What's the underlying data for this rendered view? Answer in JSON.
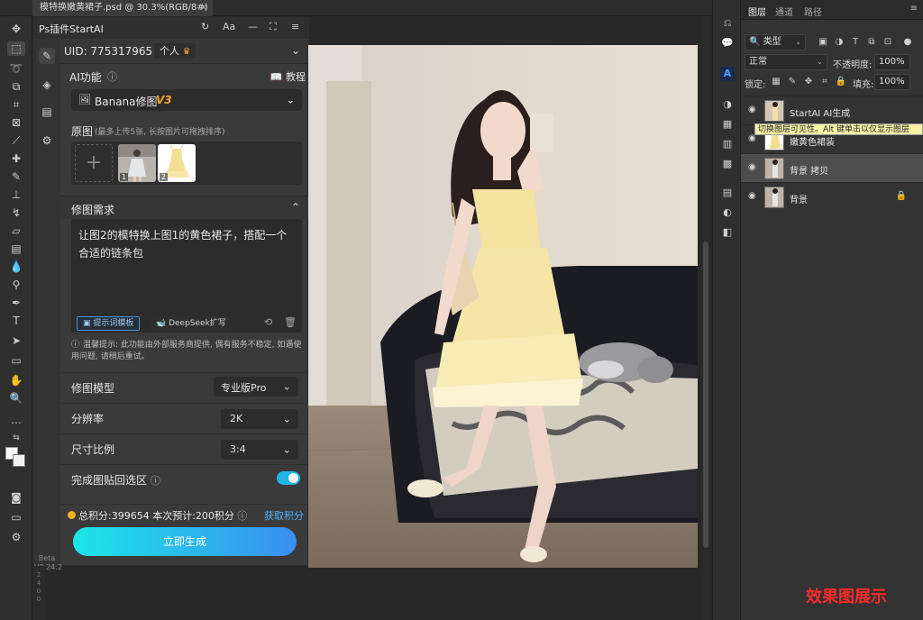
{
  "document": {
    "tab_title": "模特换嫩黄裙子.psd @ 30.3%(RGB/8#) *",
    "close": "×"
  },
  "plugin": {
    "title": "Ps插件StartAI",
    "uid": "UID: 775317965",
    "tier": "个人",
    "ai_function_label": "AI功能",
    "tutorial_label": "教程",
    "function_select": "Banana修图",
    "function_version": "V3",
    "original_label": "原图",
    "original_hint": "(最多上传5张, 长按图片可拖拽排序)",
    "thumbs": [
      "1",
      "2"
    ],
    "requirement_label": "修图需求",
    "prompt_text": "让图2的模特换上图1的黄色裙子，搭配一个合适的链条包",
    "template_button": "提示词模板",
    "deepseek_button": "DeepSeek扩写",
    "warning": "温馨提示: 此功能由外部服务商提供, 偶有服务不稳定, 如遇使用问题, 请稍后重试。",
    "model_label": "修图模型",
    "model_value": "专业版Pro",
    "resolution_label": "分辨率",
    "resolution_value": "2K",
    "ratio_label": "尺寸比例",
    "ratio_value": "3:4",
    "paste_back_label": "完成图贴回选区",
    "paste_back_on": true,
    "credits_text": "总积分:399654  本次预计:200积分",
    "get_credits": "获取积分",
    "generate_button": "立即生成",
    "beta_label": "Beta",
    "version_label": "V0.24.2"
  },
  "ruler": {
    "marks": [
      "2",
      "4",
      "0",
      "0"
    ]
  },
  "layers_panel": {
    "tabs": [
      "图层",
      "通道",
      "路径"
    ],
    "filter_select": "类型",
    "blend_mode": "正常",
    "opacity_label": "不透明度:",
    "opacity_value": "100%",
    "lock_label": "锁定:",
    "fill_label": "填充:",
    "fill_value": "100%",
    "layers": [
      {
        "name": "StartAI AI生成",
        "selected": false,
        "locked": false
      },
      {
        "name": "嫩黄色裙装",
        "selected": false,
        "locked": false
      },
      {
        "name": "背景 拷贝",
        "selected": true,
        "locked": false
      },
      {
        "name": "背景",
        "selected": false,
        "locked": true
      }
    ],
    "tooltip": "切换图层可见性。Alt 键单击以仅显示图层"
  },
  "watermark": "效果图展示",
  "colors": {
    "accent": "#1fb6e6",
    "credits_link": "#4fb4ff",
    "version_tag": "#f5a623",
    "watermark": "#ff2a2a"
  }
}
